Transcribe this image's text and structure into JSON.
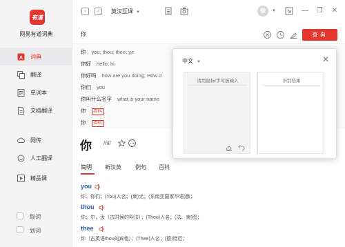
{
  "sidebar": {
    "logo_text": "有道",
    "app_name": "网易有道词典",
    "items": [
      {
        "label": "词典",
        "icon": "dictionary-icon"
      },
      {
        "label": "翻译",
        "icon": "translate-icon"
      },
      {
        "label": "单词本",
        "icon": "wordbook-icon"
      },
      {
        "label": "文档翻译",
        "icon": "document-icon"
      },
      {
        "label": "网传",
        "icon": "cloud-icon"
      },
      {
        "label": "人工翻译",
        "icon": "human-translate-icon"
      },
      {
        "label": "精品课",
        "icon": "course-icon"
      }
    ],
    "checkboxes": [
      {
        "label": "取词",
        "checked": false
      },
      {
        "label": "划词",
        "checked": false
      }
    ],
    "accent_color": "#e2362e"
  },
  "topbar": {
    "back_glyph": "‹",
    "forward_glyph": "›",
    "lang_pair": "英汉互译",
    "caret": "▼",
    "win_min": "—",
    "win_restore": "❐",
    "win_close": "✕"
  },
  "search": {
    "query": "你",
    "button_label": "查询"
  },
  "suggestions": [
    {
      "word": "你",
      "def": "you; thou; thee; ye"
    },
    {
      "word": "你好",
      "def": "hello; hi"
    },
    {
      "word": "你好吗",
      "def": "how are you doing; How d"
    },
    {
      "word": "你们",
      "def": "you"
    },
    {
      "word": "你叫什么名字",
      "def": "what is your name"
    },
    {
      "word": "你",
      "tag": "百科"
    },
    {
      "word": "你",
      "tag": "百科"
    }
  ],
  "main": {
    "word": "你",
    "phonetic": "/nǐ/",
    "tabs": [
      "简明",
      "新汉英",
      "例句",
      "百科"
    ],
    "entries": [
      {
        "word": "you",
        "def": "你；你们；(You)人名；(柬)尤；(东南亚国家华语)猷；"
      },
      {
        "word": "thou",
        "def": "你；尔，汝（古时候的叫法）；(Thou)人名；(法、柬)图；"
      },
      {
        "word": "thee",
        "def": "你（古英语thou的宾格）；(Thee)人名；(德)特厄；"
      }
    ]
  },
  "popup": {
    "language": "中文",
    "caret": "▼",
    "close": "✕",
    "handwriting_title": "请用鼠标/手写板输入",
    "result_title": "识别结果"
  }
}
